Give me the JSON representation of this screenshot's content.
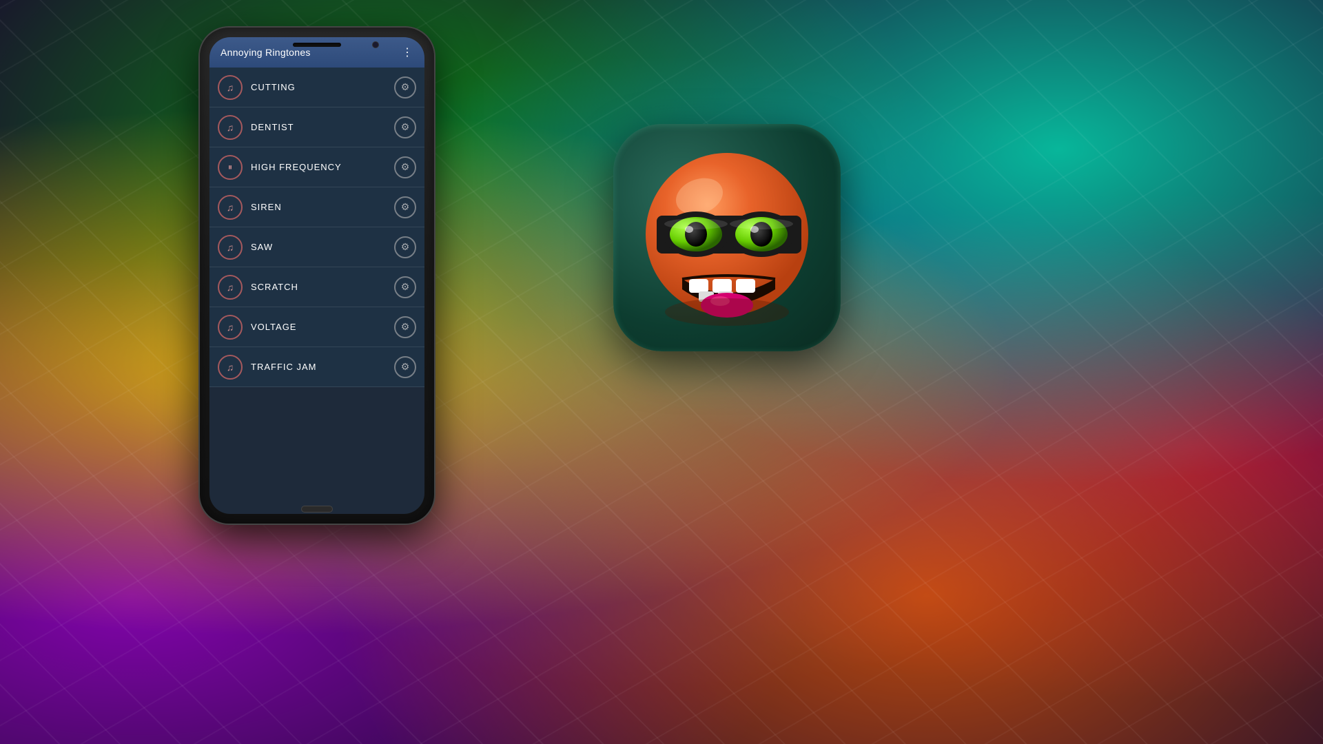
{
  "background": {
    "description": "colorful psychedelic background with light rays"
  },
  "app": {
    "header": {
      "title": "Annoying Ringtones",
      "menu_label": "⋮"
    },
    "ringtones": [
      {
        "id": "cutting",
        "name": "CUTTING",
        "icon": "music",
        "playing": false
      },
      {
        "id": "dentist",
        "name": "DENTIST",
        "icon": "music",
        "playing": false
      },
      {
        "id": "high-frequency",
        "name": "HIGH FREQUENCY",
        "icon": "pause",
        "playing": true
      },
      {
        "id": "siren",
        "name": "SIREN",
        "icon": "music",
        "playing": false
      },
      {
        "id": "saw",
        "name": "SAW",
        "icon": "music",
        "playing": false
      },
      {
        "id": "scratch",
        "name": "SCRATCH",
        "icon": "music",
        "playing": false
      },
      {
        "id": "voltage",
        "name": "VOLTAGE",
        "icon": "music",
        "playing": false
      },
      {
        "id": "traffic-jam",
        "name": "TRAFFIC JAM",
        "icon": "music",
        "playing": false
      }
    ]
  },
  "emoji_icon": {
    "description": "Angry orange emoji with sunglasses and teeth showing"
  }
}
